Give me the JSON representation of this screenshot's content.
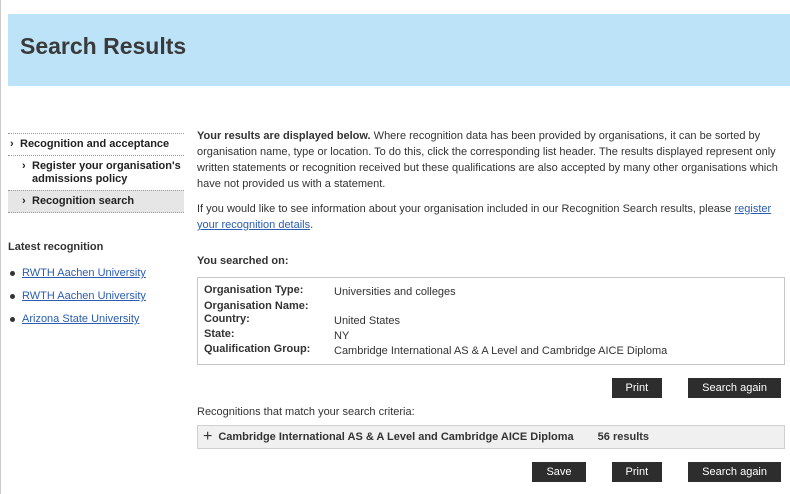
{
  "page": {
    "title": "Search Results"
  },
  "sidebar": {
    "nav": [
      {
        "label": "Recognition and acceptance"
      },
      {
        "label": "Register your organisation's admissions policy"
      },
      {
        "label": "Recognition search"
      }
    ],
    "latest_title": "Latest recognition",
    "latest": [
      {
        "label": "RWTH Aachen University"
      },
      {
        "label": "RWTH Aachen University"
      },
      {
        "label": "Arizona State University"
      }
    ]
  },
  "main": {
    "intro_bold": "Your results are displayed below.",
    "intro_text": " Where recognition data has been provided by organisations, it can be sorted by organisation name, type or location. To do this, click the corresponding list header. The results displayed represent only written statements or recognition received but these qualifications are also accepted by many other organisations which have not provided us with a statement.",
    "register_text": "If you would like to see information about your organisation included in our Recognition Search results, please ",
    "register_link": "register your recognition details",
    "register_end": ".",
    "searched_on_label": "You searched on:",
    "criteria": [
      {
        "key": "Organisation Type:",
        "value": "Universities and colleges"
      },
      {
        "key": "Organisation Name:",
        "value": ""
      },
      {
        "key": "Country:",
        "value": "United States"
      },
      {
        "key": "State:",
        "value": "NY"
      },
      {
        "key": "Qualification Group:",
        "value": "Cambridge International AS & A Level and Cambridge AICE Diploma"
      }
    ],
    "buttons": {
      "print": "Print",
      "search_again": "Search again",
      "save": "Save"
    },
    "matches_label": "Recognitions that match your search criteria:",
    "result_group": {
      "expand_icon": "+",
      "name": "Cambridge International AS & A Level and Cambridge AICE Diploma",
      "count": "56 results"
    }
  }
}
